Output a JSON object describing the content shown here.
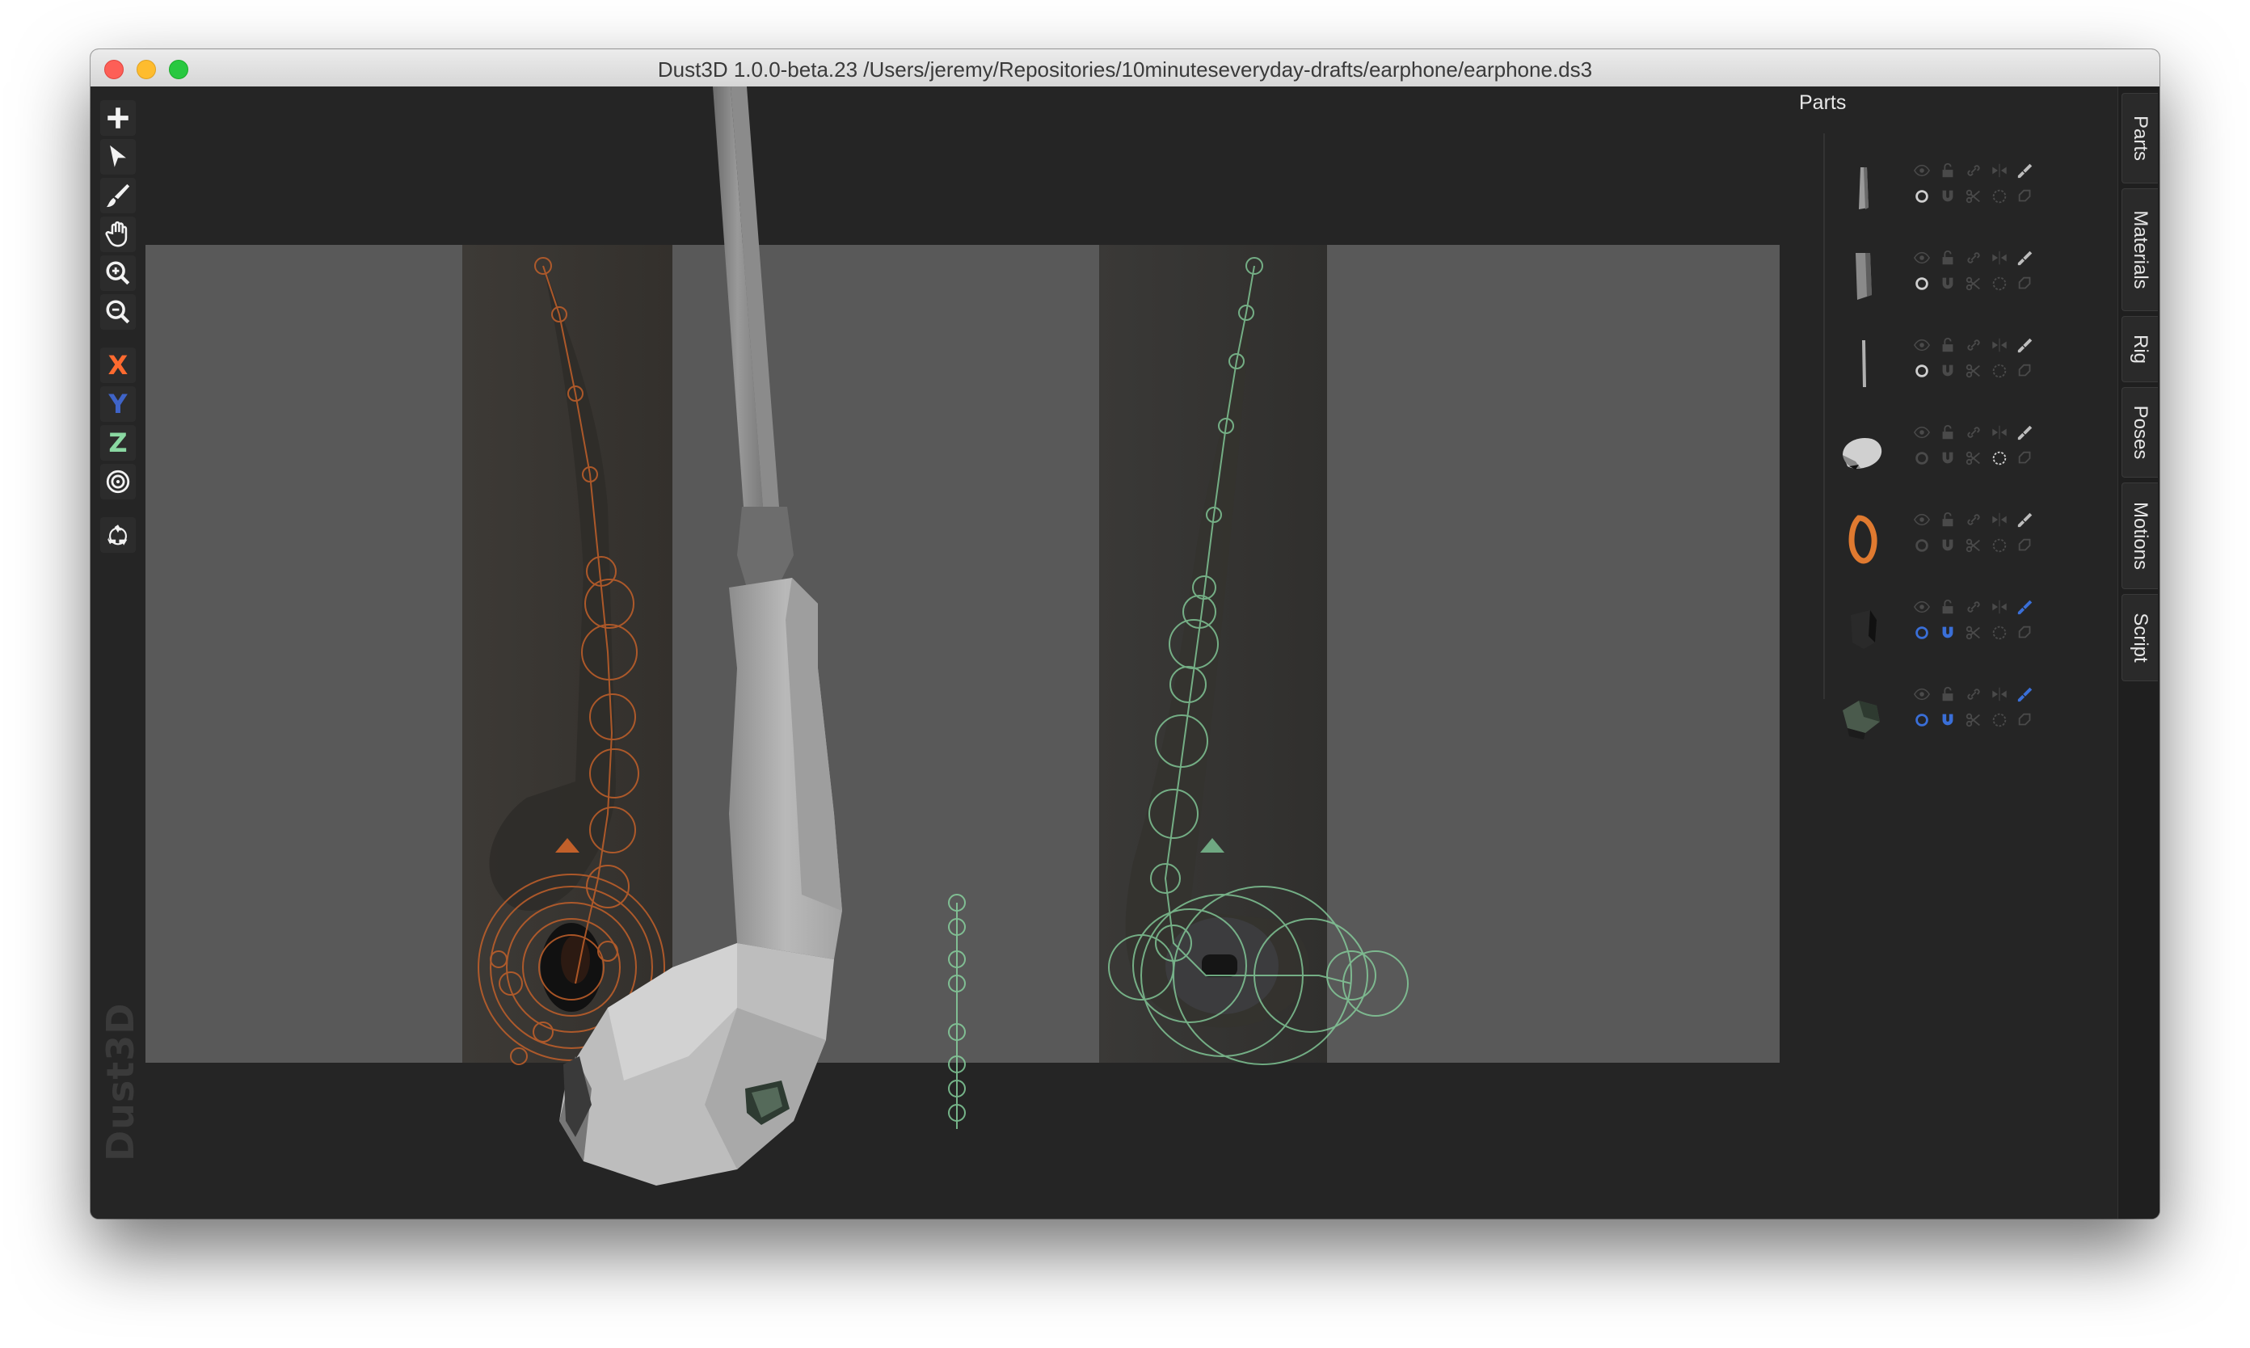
{
  "window": {
    "title": "Dust3D 1.0.0-beta.23 /Users/jeremy/Repositories/10minuteseveryday-drafts/earphone/earphone.ds3"
  },
  "toolbar": {
    "tools": [
      {
        "name": "add-icon"
      },
      {
        "name": "select-icon"
      },
      {
        "name": "paint-brush-icon"
      },
      {
        "name": "hand-drag-icon"
      },
      {
        "name": "zoom-in-icon"
      },
      {
        "name": "zoom-out-icon"
      }
    ],
    "axes": [
      {
        "label": "X",
        "color": "#ff6a2f"
      },
      {
        "label": "Y",
        "color": "#3f64c8"
      },
      {
        "label": "Z",
        "color": "#8ad8a2"
      }
    ],
    "radial_icon": "radial-target-icon",
    "regenerate_icon": "recycle-icon"
  },
  "watermark": "Dust3D",
  "parts_panel": {
    "title": "Parts",
    "parts": [
      {
        "thumb": "cable-thin",
        "color": "#9a9a9a",
        "mirror_active": false,
        "highlight": false
      },
      {
        "thumb": "cable-connector",
        "color": "#8a8a8a",
        "mirror_active": false,
        "highlight": false
      },
      {
        "thumb": "cable-line",
        "color": "#b0b0b0",
        "mirror_active": false,
        "highlight": false
      },
      {
        "thumb": "earbud-shell",
        "color": "#d0d0d0",
        "mirror_active": false,
        "highlight": false
      },
      {
        "thumb": "ring",
        "color": "#e07a30",
        "mirror_active": false,
        "highlight": false
      },
      {
        "thumb": "dark-speaker",
        "color": "#2a2a2a",
        "mirror_active": true,
        "highlight": true
      },
      {
        "thumb": "green-mesh",
        "color": "#4a5a4c",
        "mirror_active": true,
        "highlight": true
      }
    ]
  },
  "side_tabs": [
    "Parts",
    "Materials",
    "Rig",
    "Poses",
    "Motions",
    "Script"
  ],
  "colors": {
    "accent_orange": "#e07a30",
    "accent_green": "#8ad8a2",
    "accent_blue": "#3a6fd8",
    "background": "#252525"
  }
}
